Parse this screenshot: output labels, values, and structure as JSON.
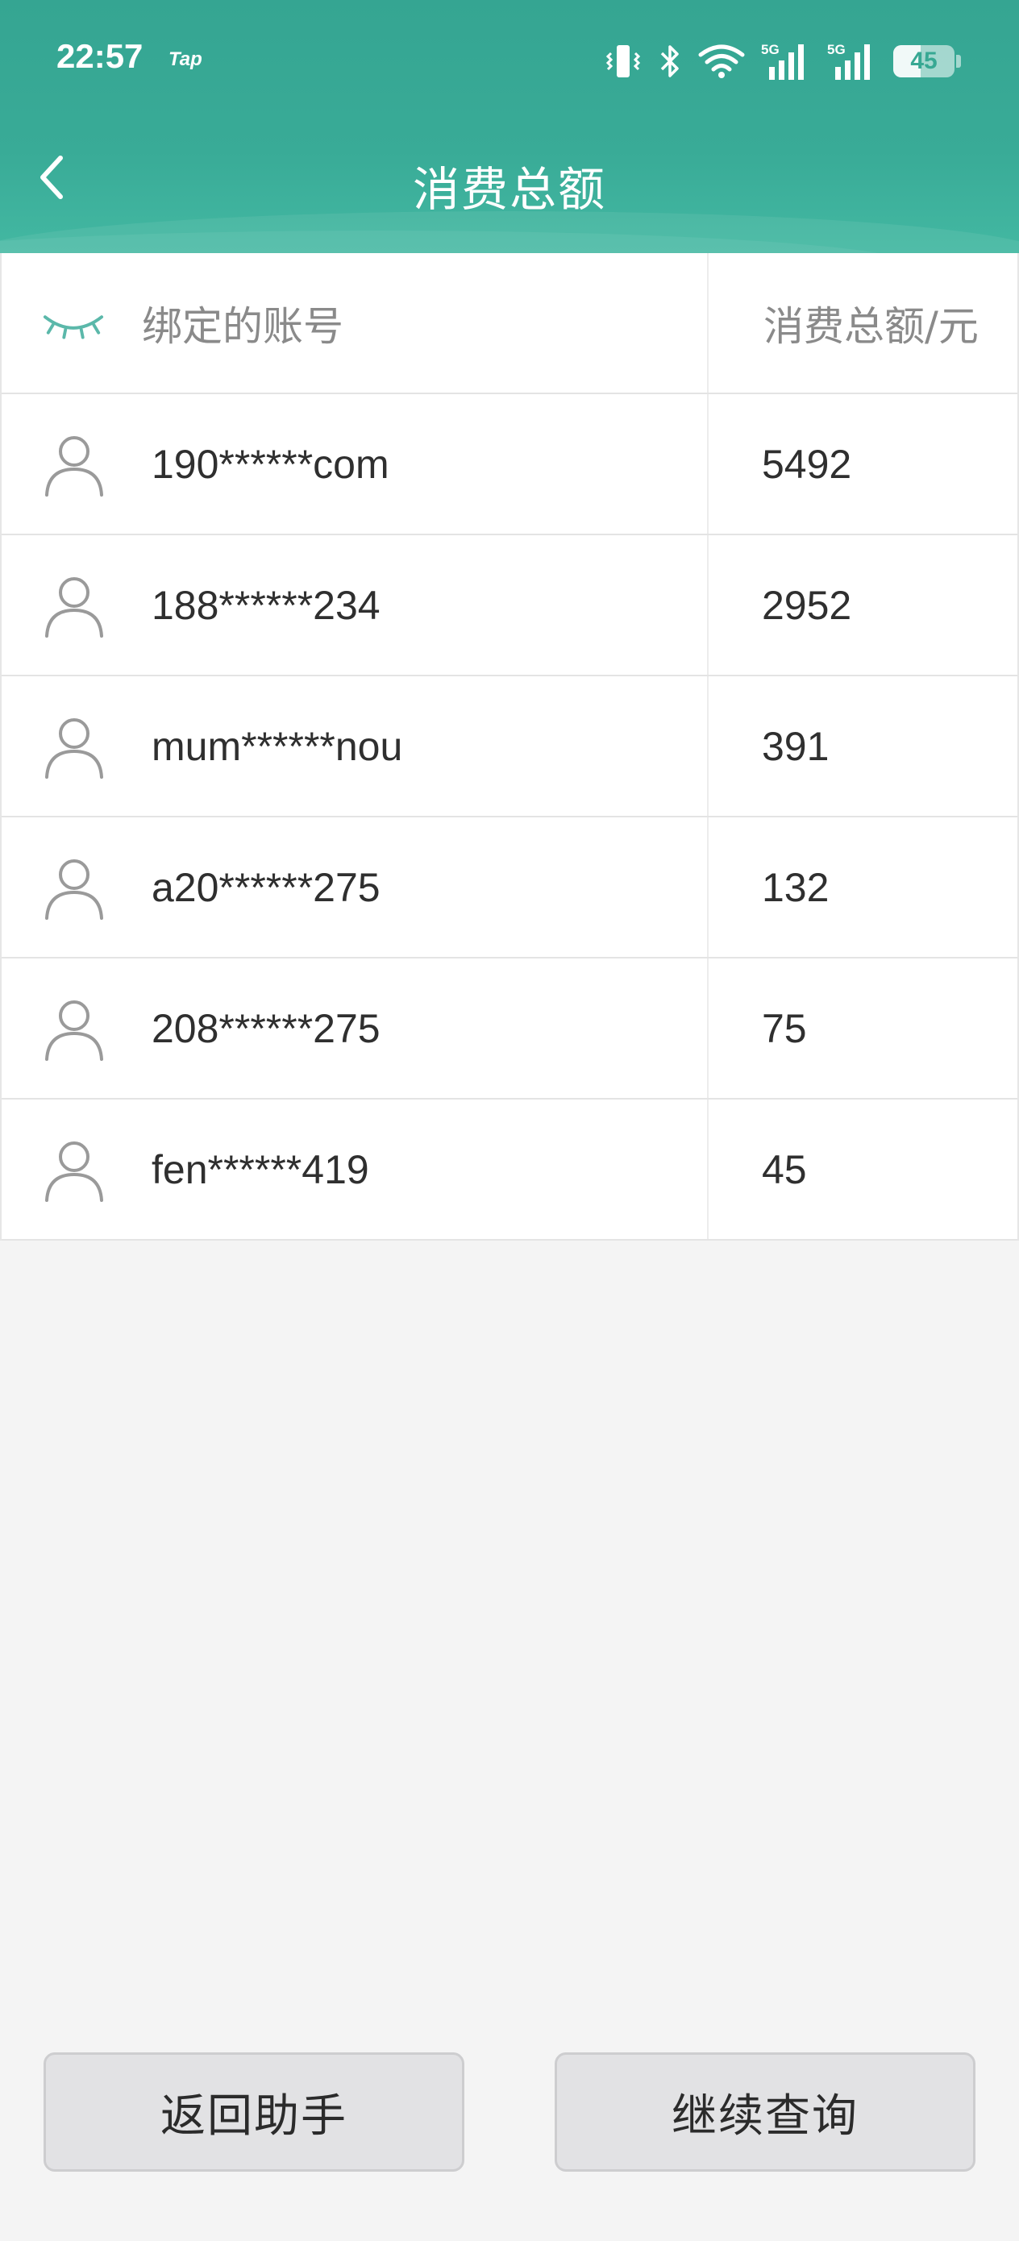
{
  "status_bar": {
    "time": "22:57",
    "carrier_label": "Tap",
    "battery_level": "45",
    "icons": [
      "vibrate-icon",
      "bluetooth-icon",
      "wifi-icon",
      "signal-5g-icon",
      "signal-5g-icon",
      "battery-icon"
    ]
  },
  "nav": {
    "title": "消费总额",
    "back_icon": "chevron-left-icon"
  },
  "table": {
    "header": {
      "visibility_icon": "eye-closed-icon",
      "account_label": "绑定的账号",
      "amount_label": "消费总额/元"
    },
    "rows": [
      {
        "account": "190******com",
        "amount": "5492"
      },
      {
        "account": "188******234",
        "amount": "2952"
      },
      {
        "account": "mum******nou",
        "amount": "391"
      },
      {
        "account": "a20******275",
        "amount": "132"
      },
      {
        "account": "208******275",
        "amount": "75"
      },
      {
        "account": "fen******419",
        "amount": "45"
      }
    ]
  },
  "buttons": {
    "back_to_assistant": "返回助手",
    "continue_query": "继续查询"
  },
  "colors": {
    "header_teal": "#38a994",
    "accent_teal": "#5bb8aa",
    "text_dark": "#2f2f2f",
    "text_muted": "#8a8a8a",
    "background": "#f4f4f4"
  }
}
